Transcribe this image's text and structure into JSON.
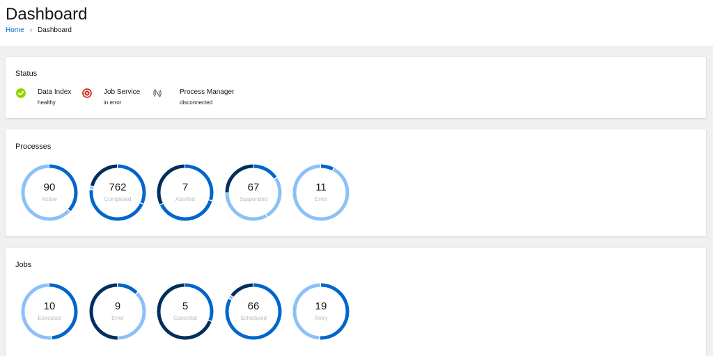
{
  "header": {
    "title": "Dashboard",
    "breadcrumb": {
      "home": "Home",
      "separator": "›",
      "current": "Dashboard"
    }
  },
  "status": {
    "title": "Status",
    "items": [
      {
        "name": "Data Index",
        "state": "healthy",
        "icon": "check-circle-icon",
        "color": "#3e8635"
      },
      {
        "name": "Job Service",
        "state": "in error",
        "icon": "error-circle-icon",
        "color": "#c9190b"
      },
      {
        "name": "Process Manager",
        "state": "disconnected",
        "icon": "disconnected-icon",
        "color": "#6a6e73"
      }
    ]
  },
  "processes": {
    "title": "Processes",
    "donuts": [
      {
        "value": "90",
        "label": "Active"
      },
      {
        "value": "762",
        "label": "Completed"
      },
      {
        "value": "7",
        "label": "Aborted"
      },
      {
        "value": "67",
        "label": "Suspended"
      },
      {
        "value": "11",
        "label": "Error"
      }
    ]
  },
  "jobs": {
    "title": "Jobs",
    "donuts": [
      {
        "value": "10",
        "label": "Executed"
      },
      {
        "value": "9",
        "label": "Error"
      },
      {
        "value": "5",
        "label": "Canceled"
      },
      {
        "value": "66",
        "label": "Scheduled"
      },
      {
        "value": "19",
        "label": "Retry"
      }
    ]
  },
  "colors": {
    "light": "#8bc1f7",
    "mid": "#0066cc",
    "dark": "#002f5d"
  }
}
